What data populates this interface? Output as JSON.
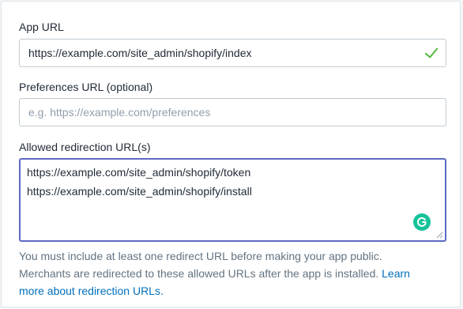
{
  "app_url": {
    "label": "App URL",
    "value": "https://example.com/site_admin/shopify/index",
    "status_icon": "check-icon",
    "status_color": "#50b83c"
  },
  "preferences_url": {
    "label": "Preferences URL (optional)",
    "placeholder": "e.g. https://example.com/preferences"
  },
  "redirection_urls": {
    "label": "Allowed redirection URL(s)",
    "lines": [
      "https://example.com/site_admin/shopify/token",
      "https://example.com/site_admin/shopify/install"
    ],
    "focus_color": "#5c6ac4"
  },
  "help": {
    "text": "You must include at least one redirect URL before making your app public. Merchants are redirected to these allowed URLs after the app is installed.",
    "link": "Learn more about redirection URLs."
  }
}
